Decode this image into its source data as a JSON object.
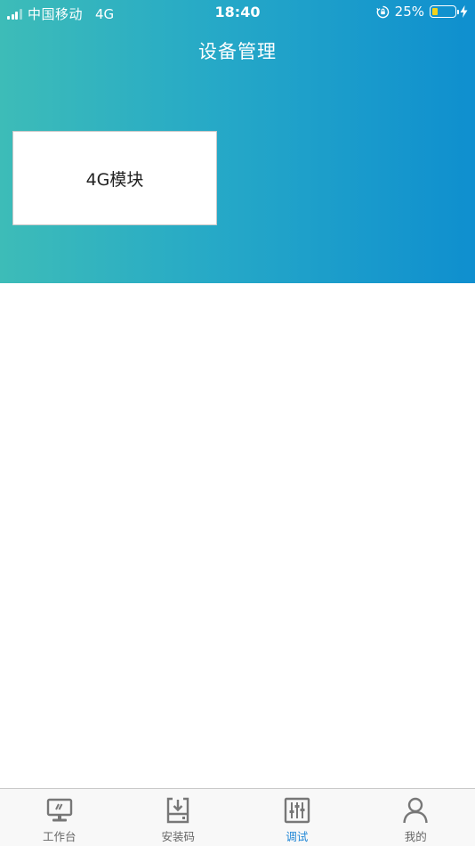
{
  "status_bar": {
    "carrier": "中国移动",
    "network": "4G",
    "time": "18:40",
    "battery_percent": "25%",
    "battery_level": 0.25,
    "battery_color": "#f2d21b"
  },
  "header": {
    "title": "设备管理",
    "gradient_colors": [
      "#3dbcb8",
      "#0f8fcf"
    ]
  },
  "modules": [
    {
      "label": "4G模块"
    }
  ],
  "tabbar": {
    "active_color": "#1f86d6",
    "inactive_color": "#666666",
    "tabs": [
      {
        "label": "工作台",
        "icon": "monitor-icon",
        "active": false
      },
      {
        "label": "安装码",
        "icon": "download-box-icon",
        "active": false
      },
      {
        "label": "调试",
        "icon": "sliders-icon",
        "active": true
      },
      {
        "label": "我的",
        "icon": "person-icon",
        "active": false
      }
    ]
  }
}
